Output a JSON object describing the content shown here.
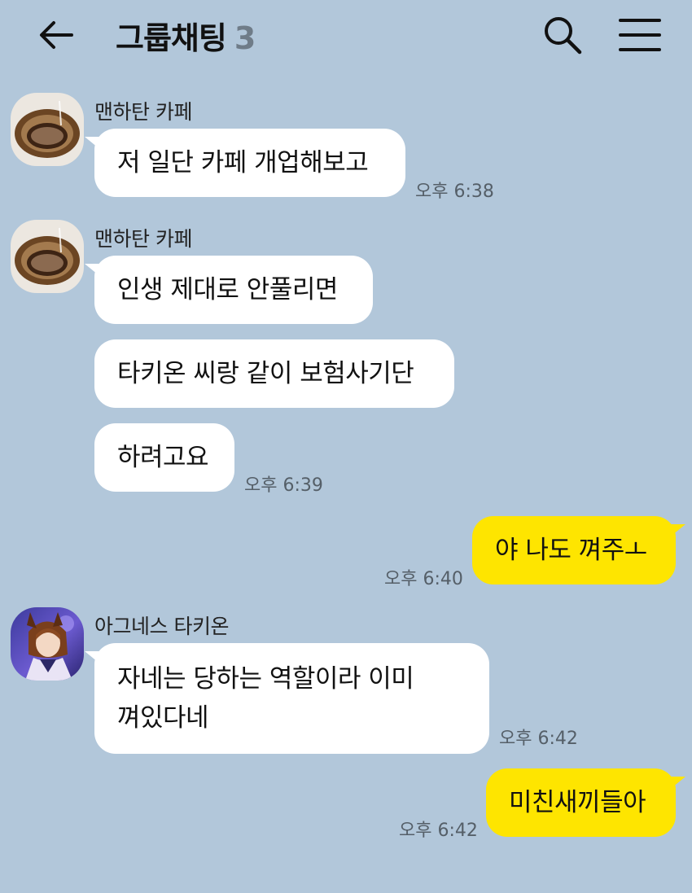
{
  "header": {
    "title": "그룹채팅",
    "member_count": "3",
    "back_icon": "arrow-left-icon",
    "search_icon": "search-icon",
    "menu_icon": "hamburger-menu-icon"
  },
  "colors": {
    "background": "#b2c7da",
    "my_bubble": "#fee500",
    "other_bubble": "#ffffff"
  },
  "messages": [
    {
      "sender": "맨하탄 카페",
      "time": "오후 6:38",
      "bubbles": [
        "저 일단 카페 개업해보고"
      ]
    },
    {
      "sender": "맨하탄 카페",
      "time": "오후 6:39",
      "bubbles": [
        "인생 제대로 안풀리면",
        "타키온 씨랑 같이 보험사기단",
        "하려고요"
      ]
    },
    {
      "sender": "me",
      "time": "오후 6:40",
      "bubbles": [
        "야 나도 껴주ㅗ"
      ]
    },
    {
      "sender": "아그네스 타키온",
      "time": "오후 6:42",
      "bubbles": [
        "자네는 당하는 역할이라 이미\n껴있다네"
      ]
    },
    {
      "sender": "me",
      "time": "오후 6:42",
      "bubbles": [
        "미친새끼들아"
      ]
    }
  ]
}
